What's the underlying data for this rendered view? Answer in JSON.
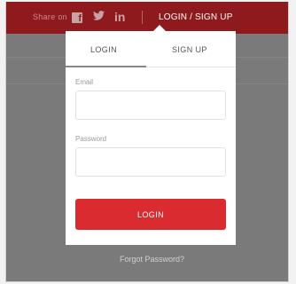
{
  "header": {
    "share_label": "Share on",
    "social_icons": [
      "facebook-icon",
      "twitter-icon",
      "linkedin-icon"
    ],
    "facebook_glyph": "f",
    "twitter_glyph": "🐦",
    "linkedin_glyph": "in",
    "auth_link": "LOGIN / SIGN UP"
  },
  "modal": {
    "tabs": [
      {
        "label": "LOGIN",
        "active": true
      },
      {
        "label": "SIGN UP",
        "active": false
      }
    ],
    "email_label": "Email",
    "email_value": "",
    "password_label": "Password",
    "password_value": "",
    "submit_label": "LOGIN"
  },
  "forgot_password": "Forgot Password?",
  "colors": {
    "topbar": "#8e1a1d",
    "accent": "#da2b31",
    "overlay": "#7a7a7a"
  }
}
